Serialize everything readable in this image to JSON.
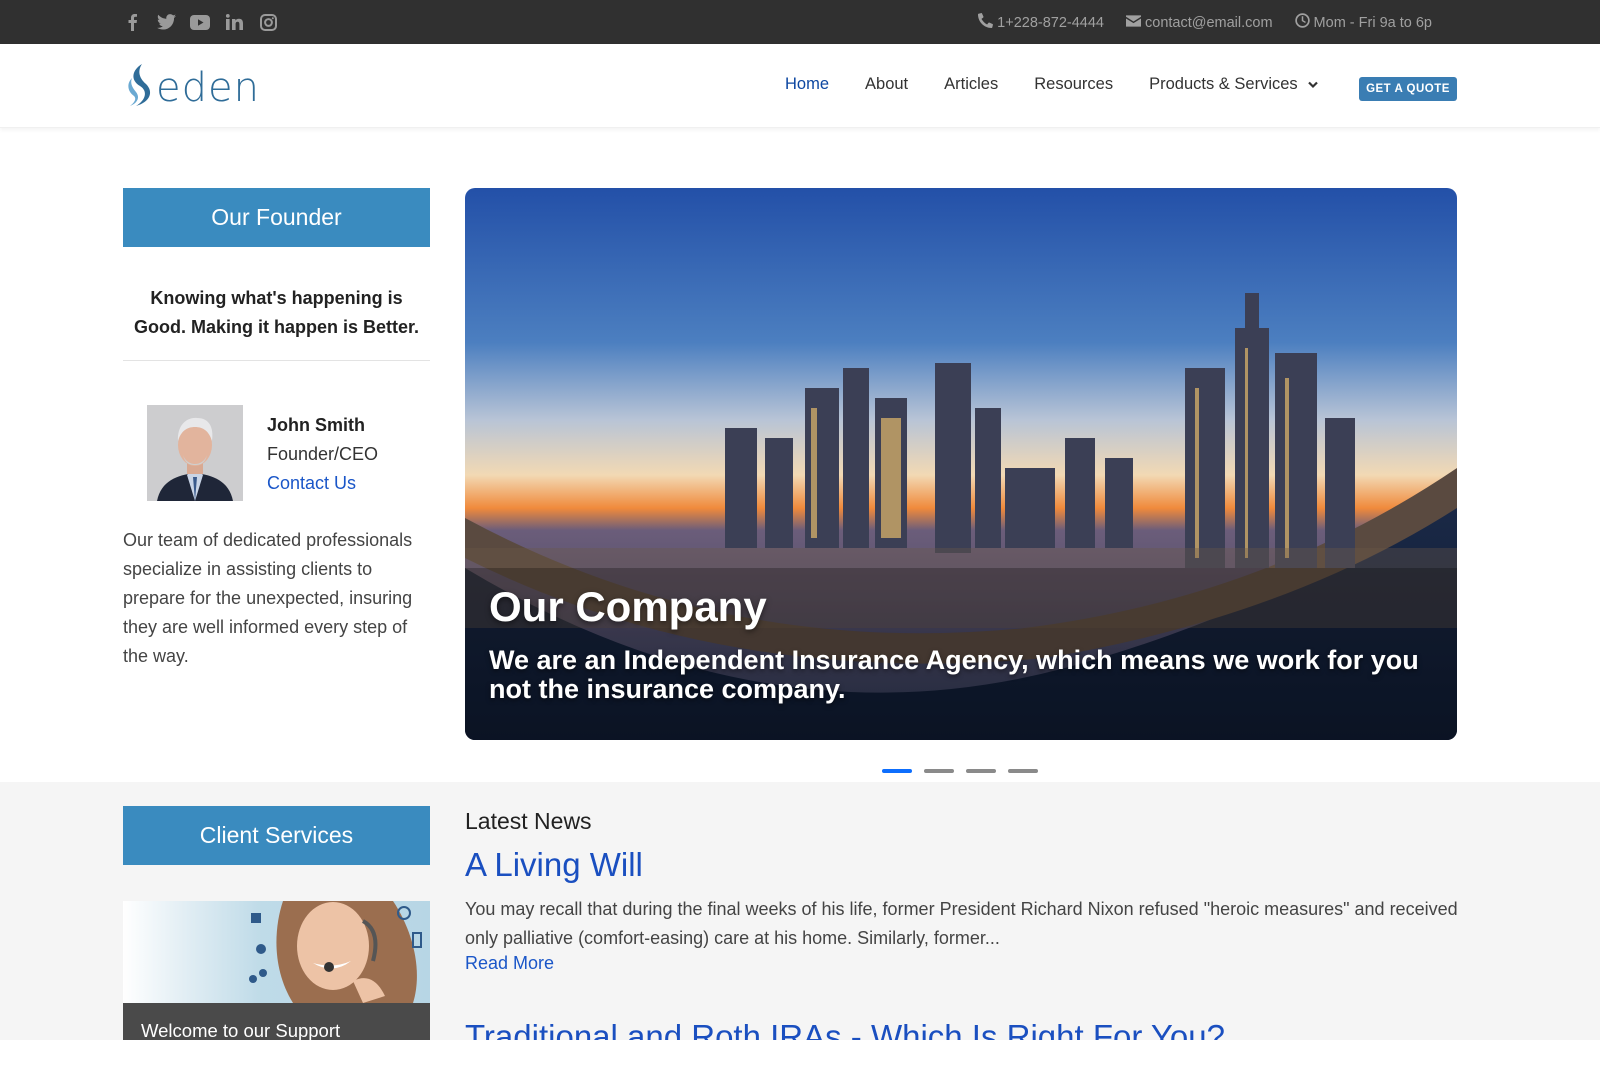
{
  "topbar": {
    "social_icons": [
      "facebook-icon",
      "twitter-icon",
      "youtube-icon",
      "linkedin-icon",
      "instagram-icon"
    ],
    "phone": "1+228-872-4444",
    "email": "contact@email.com",
    "hours": "Mom - Fri 9a to 6p"
  },
  "header": {
    "logo_text": "eden",
    "nav": [
      {
        "label": "Home",
        "active": true
      },
      {
        "label": "About"
      },
      {
        "label": "Articles"
      },
      {
        "label": "Resources"
      },
      {
        "label": "Products & Services",
        "dropdown": true
      }
    ],
    "cta_label": "GET A QUOTE"
  },
  "founder": {
    "heading": "Our Founder",
    "quote": "Knowing what's happening is Good. Making it happen is Better.",
    "name": "John Smith",
    "role": "Founder/CEO",
    "contact_label": "Contact Us",
    "about": "Our team of dedicated professionals specialize in assisting clients to prepare for the unexpected, insuring they are well informed every step of the way."
  },
  "hero": {
    "title": "Our Company",
    "subtitle": "We are an Independent Insurance Agency, which means we work for you not the insurance company.",
    "slide_count": 4,
    "active_slide": 1
  },
  "client_services": {
    "heading": "Client Services",
    "card_caption": "Welcome to our Support"
  },
  "news": {
    "label": "Latest News",
    "items": [
      {
        "title": "A Living Will",
        "excerpt": "You may recall that during the final weeks of his life, former President Richard Nixon refused \"heroic measures\" and received only palliative (comfort-easing) care at his home. Similarly, former...",
        "more_label": "Read More"
      },
      {
        "title": "Traditional and Roth IRAs - Which Is Right For You?"
      }
    ]
  },
  "colors": {
    "topbar_bg": "#303030",
    "accent_blue": "#3a8bbf",
    "link_blue": "#1a56c8",
    "nav_active": "#0d47a1",
    "indicator_active": "#0d6efd"
  }
}
